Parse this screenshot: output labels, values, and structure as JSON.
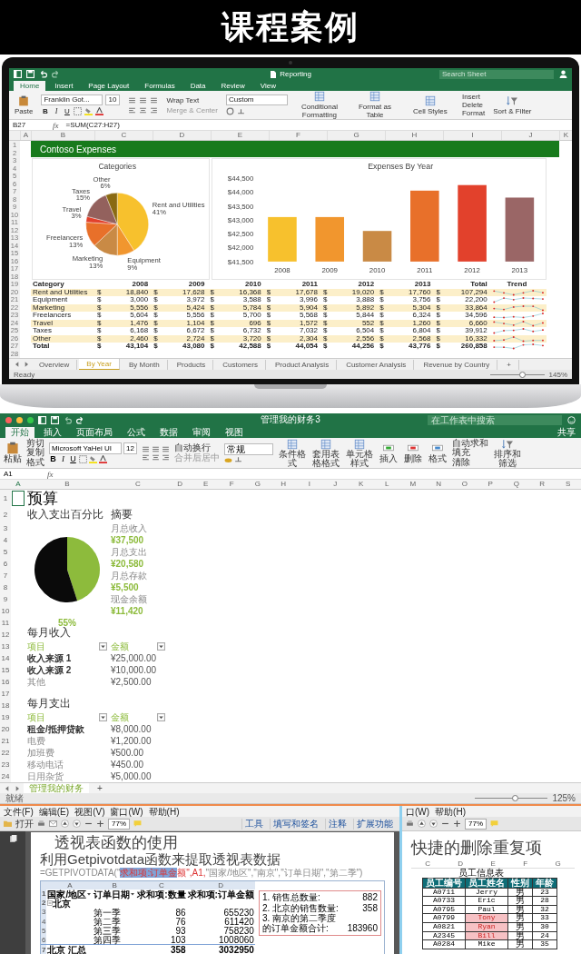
{
  "header": {
    "title": "课程案例"
  },
  "laptop_excel": {
    "title": "Reporting",
    "search": {
      "placeholder": "Search Sheet"
    },
    "tabs": [
      {
        "label": "Home",
        "selected": true
      },
      {
        "label": "Insert",
        "selected": false
      },
      {
        "label": "Page Layout",
        "selected": false
      },
      {
        "label": "Formulas",
        "selected": false
      },
      {
        "label": "Data",
        "selected": false
      },
      {
        "label": "Review",
        "selected": false
      },
      {
        "label": "View",
        "selected": false
      }
    ],
    "ribbon": {
      "paste": "Paste",
      "font": "Franklin Got...",
      "size": "10",
      "format_buttons": [
        "B",
        "I",
        "U"
      ],
      "wrap_text": "Wrap Text",
      "merge": {
        "label": "Merge & Center",
        "disabled": true
      },
      "number_format": "Custom",
      "style_buttons": [
        "Conditional Formatting",
        "Format as Table",
        "Cell Styles"
      ],
      "cell_buttons": [
        "Insert",
        "Delete",
        "Format"
      ],
      "sort": "Sort & Filter"
    },
    "name_box": "B27",
    "fx": "fx",
    "formula": "=SUM(C27:H27)",
    "columns": [
      "A",
      "B",
      "C",
      "D",
      "E",
      "F",
      "G",
      "H",
      "I",
      "J",
      "K"
    ],
    "rows": [
      "1",
      "2",
      "3",
      "4",
      "5",
      "6",
      "7",
      "8",
      "9",
      "10",
      "11",
      "12",
      "13",
      "14",
      "15",
      "16",
      "17",
      "18",
      "19",
      "20",
      "21",
      "22",
      "23",
      "24",
      "25",
      "26",
      "27",
      "28"
    ],
    "banner": "Contoso Expenses",
    "pie_chart": {
      "chart_data": {
        "type": "pie",
        "title": "Categories",
        "categories": [
          "Rent and Utilities",
          "Equipment",
          "Marketing",
          "Freelancers",
          "Travel",
          "Taxes",
          "Other"
        ],
        "values": [
          41,
          9,
          13,
          13,
          3,
          15,
          6
        ],
        "value_labels": [
          "41%",
          "9%",
          "13%",
          "13%",
          "3%",
          "15%",
          "6%"
        ]
      }
    },
    "bar_chart": {
      "chart_data": {
        "type": "bar",
        "title": "Expenses By Year",
        "categories": [
          "2008",
          "2009",
          "2010",
          "2011",
          "2012",
          "2013"
        ],
        "values": [
          43100,
          43100,
          42600,
          44050,
          44250,
          43800
        ],
        "ylim": [
          41500,
          44500
        ],
        "yticks": [
          {
            "value": 41500,
            "label": "$41,500"
          },
          {
            "value": 42000,
            "label": "$42,000"
          },
          {
            "value": 42500,
            "label": "$42,500"
          },
          {
            "value": 43000,
            "label": "$43,000"
          },
          {
            "value": 43500,
            "label": "$43,500"
          },
          {
            "value": 44000,
            "label": "$44,000"
          },
          {
            "value": 44500,
            "label": "$44,500"
          }
        ]
      }
    },
    "table": {
      "columns": [
        "Category",
        "2008",
        "2009",
        "2010",
        "2011",
        "2012",
        "2013",
        "Total",
        "Trend"
      ],
      "rows": [
        {
          "kind": "item",
          "cells": [
            {
              "text": "Rent and Utilities"
            },
            {
              "currency": "$",
              "text": "18,840"
            },
            {
              "currency": "$",
              "text": "17,628"
            },
            {
              "currency": "$",
              "text": "16,368"
            },
            {
              "currency": "$",
              "text": "17,678"
            },
            {
              "currency": "$",
              "text": "19,020"
            },
            {
              "currency": "$",
              "text": "17,760"
            },
            {
              "currency": "$",
              "text": "107,294"
            }
          ]
        },
        {
          "kind": "item",
          "cells": [
            {
              "text": "Equipment"
            },
            {
              "currency": "$",
              "text": "3,000"
            },
            {
              "currency": "$",
              "text": "3,972"
            },
            {
              "currency": "$",
              "text": "3,588"
            },
            {
              "currency": "$",
              "text": "3,996"
            },
            {
              "currency": "$",
              "text": "3,888"
            },
            {
              "currency": "$",
              "text": "3,756"
            },
            {
              "currency": "$",
              "text": "22,200"
            }
          ]
        },
        {
          "kind": "item",
          "cells": [
            {
              "text": "Marketing"
            },
            {
              "currency": "$",
              "text": "5,556"
            },
            {
              "currency": "$",
              "text": "5,424"
            },
            {
              "currency": "$",
              "text": "5,784"
            },
            {
              "currency": "$",
              "text": "5,904"
            },
            {
              "currency": "$",
              "text": "5,892"
            },
            {
              "currency": "$",
              "text": "5,304"
            },
            {
              "currency": "$",
              "text": "33,864"
            }
          ]
        },
        {
          "kind": "item",
          "cells": [
            {
              "text": "Freelancers"
            },
            {
              "currency": "$",
              "text": "5,604"
            },
            {
              "currency": "$",
              "text": "5,556"
            },
            {
              "currency": "$",
              "text": "5,700"
            },
            {
              "currency": "$",
              "text": "5,568"
            },
            {
              "currency": "$",
              "text": "5,844"
            },
            {
              "currency": "$",
              "text": "6,324"
            },
            {
              "currency": "$",
              "text": "34,596"
            }
          ]
        },
        {
          "kind": "item",
          "cells": [
            {
              "text": "Travel"
            },
            {
              "currency": "$",
              "text": "1,476"
            },
            {
              "currency": "$",
              "text": "1,104"
            },
            {
              "currency": "$",
              "text": "696"
            },
            {
              "currency": "$",
              "text": "1,572"
            },
            {
              "currency": "$",
              "text": "552"
            },
            {
              "currency": "$",
              "text": "1,260"
            },
            {
              "currency": "$",
              "text": "6,660"
            }
          ]
        },
        {
          "kind": "item",
          "cells": [
            {
              "text": "Taxes"
            },
            {
              "currency": "$",
              "text": "6,168"
            },
            {
              "currency": "$",
              "text": "6,672"
            },
            {
              "currency": "$",
              "text": "6,732"
            },
            {
              "currency": "$",
              "text": "7,032"
            },
            {
              "currency": "$",
              "text": "6,504"
            },
            {
              "currency": "$",
              "text": "6,804"
            },
            {
              "currency": "$",
              "text": "39,912"
            }
          ]
        },
        {
          "kind": "item",
          "cells": [
            {
              "text": "Other"
            },
            {
              "currency": "$",
              "text": "2,460"
            },
            {
              "currency": "$",
              "text": "2,724"
            },
            {
              "currency": "$",
              "text": "3,720"
            },
            {
              "currency": "$",
              "text": "2,304"
            },
            {
              "currency": "$",
              "text": "2,556"
            },
            {
              "currency": "$",
              "text": "2,568"
            },
            {
              "currency": "$",
              "text": "16,332"
            }
          ]
        },
        {
          "kind": "total",
          "cells": [
            {
              "text": "Total"
            },
            {
              "currency": "$",
              "text": "43,104"
            },
            {
              "currency": "$",
              "text": "43,080"
            },
            {
              "currency": "$",
              "text": "42,588"
            },
            {
              "currency": "$",
              "text": "44,054"
            },
            {
              "currency": "$",
              "text": "44,256"
            },
            {
              "currency": "$",
              "text": "43,776"
            },
            {
              "currency": "$",
              "text": "260,858"
            }
          ]
        }
      ]
    },
    "sheet_tabs": [
      {
        "label": "Overview",
        "selected": false
      },
      {
        "label": "By Year",
        "selected": true
      },
      {
        "label": "By Month",
        "selected": false
      },
      {
        "label": "Products",
        "selected": false
      },
      {
        "label": "Customers",
        "selected": false
      },
      {
        "label": "Product Analysis",
        "selected": false
      },
      {
        "label": "Customer Analysis",
        "selected": false
      },
      {
        "label": "Revenue by Country",
        "selected": false
      }
    ],
    "add_sheet": "+",
    "status": "Ready",
    "zoom_slider": {
      "level": 0.6
    },
    "zoom": "145%"
  },
  "finance_excel": {
    "title": "管理我的财务3",
    "search": {
      "placeholder": "在工作表中搜索"
    },
    "share": "共享",
    "tabs": [
      {
        "label": "开始",
        "selected": true
      },
      {
        "label": "插入",
        "selected": false
      },
      {
        "label": "页面布局",
        "selected": false
      },
      {
        "label": "公式",
        "selected": false
      },
      {
        "label": "数据",
        "selected": false
      },
      {
        "label": "审阅",
        "selected": false
      },
      {
        "label": "视图",
        "selected": false
      }
    ],
    "ribbon": {
      "paste": "粘贴",
      "clipboard": [
        "剪切",
        "复制",
        "格式"
      ],
      "font": "Microsoft YaHei UI",
      "size": "12",
      "format_buttons": [
        "B",
        "I",
        "U"
      ],
      "wrap_text": "自动换行",
      "merge": {
        "label": "合并后居中",
        "disabled": true
      },
      "number_format": "常规",
      "style_buttons": [
        "条件格式",
        "套用表格格式",
        "单元格样式"
      ],
      "cell_buttons": [
        "插入",
        "删除",
        "格式"
      ],
      "editing": [
        "自动求和",
        "填充",
        "清除"
      ],
      "sort": "排序和筛选"
    },
    "name_box": "A1",
    "fx": "fx",
    "columns": [
      "A",
      "B",
      "C",
      "D",
      "E",
      "F",
      "G",
      "H",
      "I",
      "J",
      "K",
      "L",
      "M",
      "N",
      "O",
      "P",
      "Q",
      "R",
      "S"
    ],
    "rows": [
      "1",
      "2",
      "3",
      "4",
      "5",
      "6",
      "7",
      "8",
      "9",
      "10",
      "11",
      "12",
      "13",
      "14",
      "15",
      "16",
      "17",
      "18",
      "19",
      "20",
      "21",
      "22",
      "23",
      "24"
    ],
    "sheet_title": "预算",
    "chart_heading": "收入支出百分比",
    "pie_chart": {
      "chart_data": {
        "type": "pie",
        "values": [
          45,
          55
        ]
      }
    },
    "pie_label": "55%",
    "summary": {
      "heading": "摘要",
      "items": [
        {
          "label": "月总收入",
          "value": "¥37,500"
        },
        {
          "label": "月总支出",
          "value": "¥20,580"
        },
        {
          "label": "月总存款",
          "value": "¥5,500"
        },
        {
          "label": "现金余额",
          "value": "¥11,420"
        }
      ]
    },
    "income": {
      "heading": "每月收入",
      "columns": [
        "项目",
        "金额"
      ],
      "rows": [
        {
          "item": "收入来源 1",
          "amount": "¥25,000.00",
          "bold": true
        },
        {
          "item": "收入来源 2",
          "amount": "¥10,000.00",
          "bold": true
        },
        {
          "item": "其他",
          "amount": "¥2,500.00",
          "bold": false
        }
      ]
    },
    "expenses": {
      "heading": "每月支出",
      "columns": [
        "项目",
        "金额"
      ],
      "rows": [
        {
          "item": "租金/抵押贷款",
          "amount": "¥8,000.00",
          "bold": true
        },
        {
          "item": "电费",
          "amount": "¥1,200.00",
          "bold": false
        },
        {
          "item": "加班费",
          "amount": "¥500.00",
          "bold": false
        },
        {
          "item": "移动电话",
          "amount": "¥450.00",
          "bold": false
        },
        {
          "item": "日用杂货",
          "amount": "¥5,000.00",
          "bold": false
        }
      ]
    },
    "sheet_tabs": [
      {
        "label": "管理我的财务",
        "selected": true
      }
    ],
    "add_sheet": "+",
    "status": "就绪",
    "zoom_slider": {
      "level": 0.55
    },
    "zoom": "125%"
  },
  "pdf_left": {
    "menu": [
      "文件(F)",
      "编辑(E)",
      "视图(V)",
      "窗口(W)",
      "帮助(H)"
    ],
    "open": "打开",
    "zoom": "77%",
    "links": [
      "工具",
      "填写和签名",
      "注释",
      "扩展功能"
    ],
    "title": "透视表函数的使用",
    "subtitle": "利用Getpivotdata函数来提取透视表数据",
    "formula": [
      {
        "kind": "plain",
        "text": "=GETPIVOTDATA(\""
      },
      {
        "kind": "selected",
        "text": "求和项:订单金"
      },
      {
        "kind": "red",
        "text": "额\",A1,"
      },
      {
        "kind": "plain",
        "text": "\"国家/地区\",\"南京\",\"订单日期\",\"第二季\")"
      }
    ],
    "sheet": {
      "columns": [
        "A",
        "B",
        "C",
        "D"
      ],
      "rows": [
        {
          "num": "1",
          "kind": "header",
          "region": "国家/地区",
          "date": "订单日期",
          "qty": "求和项:数量",
          "amount": "求和项:订单金额"
        },
        {
          "num": "2",
          "kind": "group",
          "region": "北京"
        },
        {
          "num": "3",
          "kind": "item",
          "date": "第一季",
          "qty": "86",
          "amount": "655230"
        },
        {
          "num": "4",
          "kind": "item",
          "date": "第二季",
          "qty": "76",
          "amount": "611420"
        },
        {
          "num": "5",
          "kind": "item",
          "date": "第三季",
          "qty": "93",
          "amount": "758230"
        },
        {
          "num": "6",
          "kind": "item",
          "date": "第四季",
          "qty": "103",
          "amount": "1008060"
        },
        {
          "num": "7",
          "kind": "total",
          "region": "北京 汇总",
          "qty": "358",
          "amount": "3032950"
        }
      ],
      "notes": [
        {
          "label": "1. 销售总数量:",
          "value": "882"
        },
        {
          "label": "2. 北京的销售数量:",
          "value": "358"
        },
        {
          "label": "3. 南京的第二季度的订单金额合计:",
          "value": "183960"
        }
      ]
    }
  },
  "pdf_right": {
    "menu": [
      "口(W)",
      "帮助(H)"
    ],
    "zoom": "77%",
    "title": "快捷的删除重复项",
    "columns": [
      "C",
      "D",
      "E",
      "F",
      "G"
    ],
    "table_title": "员工信息表",
    "headers": [
      "员工编号",
      "员工姓名",
      "性别",
      "年龄"
    ],
    "rows": [
      {
        "id": "A0711",
        "name": "Jerry",
        "sex": "男",
        "age": "23",
        "duplicate": false
      },
      {
        "id": "A0733",
        "name": "Eric",
        "sex": "男",
        "age": "28",
        "duplicate": false
      },
      {
        "id": "A0795",
        "name": "Paul",
        "sex": "男",
        "age": "32",
        "duplicate": false
      },
      {
        "id": "A0799",
        "name": "Tony",
        "sex": "男",
        "age": "33",
        "duplicate": true
      },
      {
        "id": "A0821",
        "name": "Ryan",
        "sex": "男",
        "age": "30",
        "duplicate": true
      },
      {
        "id": "A2345",
        "name": "Bill",
        "sex": "男",
        "age": "24",
        "duplicate": true
      },
      {
        "id": "A0284",
        "name": "Mike",
        "sex": "男",
        "age": "35",
        "duplicate": false
      }
    ]
  }
}
